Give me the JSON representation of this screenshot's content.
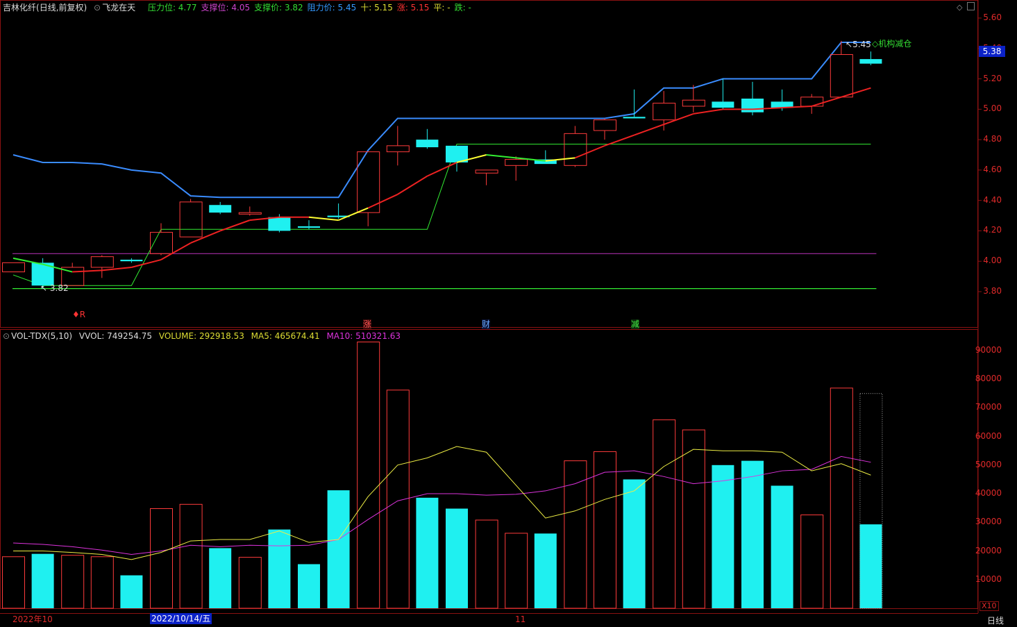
{
  "header": {
    "stock_title": "吉林化纤",
    "period": "(日线,前复权)",
    "indicator_name": "飞龙在天",
    "items": [
      {
        "label": "压力位:",
        "value": "4.77",
        "color": "#33dd33"
      },
      {
        "label": "支撑位:",
        "value": "4.05",
        "color": "#cc44cc"
      },
      {
        "label": "支撑价:",
        "value": "3.82",
        "color": "#33dd33"
      },
      {
        "label": "阻力价:",
        "value": "5.45",
        "color": "#3399ff"
      },
      {
        "label": "十:",
        "value": "5.15",
        "color": "#dddd33"
      },
      {
        "label": "涨:",
        "value": "5.15",
        "color": "#ff3333"
      },
      {
        "label": "平:",
        "value": "-",
        "color": "#dddd33"
      },
      {
        "label": "跌:",
        "value": "-",
        "color": "#33dd33"
      }
    ]
  },
  "vol_header": {
    "name": "VOL-TDX(5,10)",
    "vvol": "VVOL: 749254.75",
    "volume": "VOLUME: 292918.53",
    "ma5": "MA5: 465674.41",
    "ma10": "MA10: 510321.63"
  },
  "price_axis": [
    "5.60",
    "5.40",
    "5.20",
    "5.00",
    "4.80",
    "4.60",
    "4.40",
    "4.20",
    "4.00",
    "3.80"
  ],
  "price_tag": "5.38",
  "vol_axis": [
    "90000",
    "80000",
    "70000",
    "60000",
    "50000",
    "40000",
    "30000",
    "20000",
    "10000"
  ],
  "vol_unit": "X10",
  "annotations": {
    "high_label": "5.45",
    "low_label": "3.82",
    "event_label": "◇机构减仓",
    "marker_r": "R",
    "marker_zhang": "涨",
    "marker_cai": "财",
    "marker_jian": "减"
  },
  "bottom": {
    "date1": "2022年10",
    "selected_date": "2022/10/14/五",
    "date2": "11",
    "period_button": "日线"
  },
  "colors": {
    "up": "#ff3b3b",
    "down": "#1ff0f0",
    "bg": "#000000",
    "grid": "#7a1010"
  },
  "chart_data": {
    "type": "candlestick",
    "candles": [
      {
        "o": 3.93,
        "c": 3.99,
        "h": 3.99,
        "l": 3.93,
        "up": true
      },
      {
        "o": 3.99,
        "c": 3.84,
        "h": 4.02,
        "l": 3.82,
        "up": false
      },
      {
        "o": 3.84,
        "c": 3.96,
        "h": 3.99,
        "l": 3.84,
        "up": true
      },
      {
        "o": 3.96,
        "c": 4.03,
        "h": 4.04,
        "l": 3.89,
        "up": true
      },
      {
        "o": 4.01,
        "c": 4.0,
        "h": 4.02,
        "l": 3.99,
        "up": false
      },
      {
        "o": 4.05,
        "c": 4.19,
        "h": 4.25,
        "l": 4.04,
        "up": true
      },
      {
        "o": 4.16,
        "c": 4.39,
        "h": 4.41,
        "l": 4.16,
        "up": true
      },
      {
        "o": 4.37,
        "c": 4.32,
        "h": 4.39,
        "l": 4.31,
        "up": false
      },
      {
        "o": 4.31,
        "c": 4.32,
        "h": 4.36,
        "l": 4.3,
        "up": true
      },
      {
        "o": 4.29,
        "c": 4.2,
        "h": 4.31,
        "l": 4.19,
        "up": false
      },
      {
        "o": 4.23,
        "c": 4.22,
        "h": 4.27,
        "l": 4.21,
        "up": false
      },
      {
        "o": 4.3,
        "c": 4.29,
        "h": 4.38,
        "l": 4.28,
        "up": false
      },
      {
        "o": 4.32,
        "c": 4.72,
        "h": 4.72,
        "l": 4.23,
        "up": true
      },
      {
        "o": 4.72,
        "c": 4.76,
        "h": 4.89,
        "l": 4.63,
        "up": true
      },
      {
        "o": 4.8,
        "c": 4.75,
        "h": 4.87,
        "l": 4.74,
        "up": false
      },
      {
        "o": 4.76,
        "c": 4.65,
        "h": 4.76,
        "l": 4.59,
        "up": false
      },
      {
        "o": 4.58,
        "c": 4.6,
        "h": 4.6,
        "l": 4.5,
        "up": true
      },
      {
        "o": 4.63,
        "c": 4.67,
        "h": 4.69,
        "l": 4.53,
        "up": true
      },
      {
        "o": 4.67,
        "c": 4.64,
        "h": 4.73,
        "l": 4.64,
        "up": false
      },
      {
        "o": 4.63,
        "c": 4.84,
        "h": 4.89,
        "l": 4.62,
        "up": true
      },
      {
        "o": 4.86,
        "c": 4.93,
        "h": 4.94,
        "l": 4.8,
        "up": true
      },
      {
        "o": 4.95,
        "c": 4.94,
        "h": 5.13,
        "l": 4.94,
        "up": false
      },
      {
        "o": 4.93,
        "c": 5.04,
        "h": 5.12,
        "l": 4.86,
        "up": true
      },
      {
        "o": 5.02,
        "c": 5.06,
        "h": 5.16,
        "l": 4.98,
        "up": true
      },
      {
        "o": 5.05,
        "c": 5.01,
        "h": 5.2,
        "l": 5.0,
        "up": false
      },
      {
        "o": 5.07,
        "c": 4.98,
        "h": 5.18,
        "l": 4.96,
        "up": false
      },
      {
        "o": 5.05,
        "c": 5.01,
        "h": 5.13,
        "l": 4.99,
        "up": false
      },
      {
        "o": 5.02,
        "c": 5.08,
        "h": 5.1,
        "l": 4.97,
        "up": true
      },
      {
        "o": 5.08,
        "c": 5.36,
        "h": 5.45,
        "l": 5.08,
        "up": true
      },
      {
        "o": 5.33,
        "c": 5.3,
        "h": 5.38,
        "l": 5.29,
        "up": false
      }
    ],
    "ma_line": [
      4.02,
      3.98,
      3.93,
      3.94,
      3.96,
      4.01,
      4.12,
      4.2,
      4.27,
      4.29,
      4.29,
      4.27,
      4.35,
      4.44,
      4.56,
      4.65,
      4.7,
      4.68,
      4.66,
      4.68,
      4.76,
      4.83,
      4.9,
      4.97,
      5.0,
      5.0,
      5.01,
      5.02,
      5.08,
      5.14
    ],
    "resist_line": [
      4.7,
      4.65,
      4.65,
      4.64,
      4.6,
      4.58,
      4.43,
      4.42,
      4.42,
      4.42,
      4.42,
      4.42,
      4.73,
      4.94,
      4.94,
      4.94,
      4.94,
      4.94,
      4.94,
      4.94,
      4.94,
      4.97,
      5.14,
      5.14,
      5.2,
      5.2,
      5.2,
      5.2,
      5.44,
      5.44
    ],
    "support_step": [
      3.91,
      3.84,
      3.84,
      3.84,
      3.84,
      4.21,
      4.21,
      4.21,
      4.21,
      4.21,
      4.21,
      4.21,
      4.21,
      4.21,
      4.21,
      4.77,
      4.77,
      4.77,
      4.77,
      4.77,
      4.77,
      4.77,
      4.77,
      4.77,
      4.77,
      4.77,
      4.77,
      4.77,
      4.77,
      4.77
    ],
    "level_lines": {
      "pressure": 4.77,
      "support": 4.05,
      "support_price": 3.82
    },
    "volumes": [
      18000,
      19000,
      18500,
      18000,
      11500,
      34800,
      36300,
      21000,
      17800,
      27500,
      15400,
      41200,
      93000,
      76200,
      38600,
      34800,
      30800,
      26200,
      26100,
      51500,
      54700,
      45000,
      65800,
      62300,
      50000,
      51500,
      42800,
      32600,
      76900,
      29300
    ],
    "vol_ma5": [
      20000,
      20000,
      19500,
      18800,
      17000,
      19500,
      23500,
      24000,
      24000,
      27000,
      23000,
      24000,
      39000,
      50000,
      52500,
      56500,
      54500,
      43000,
      31500,
      34000,
      38000,
      41000,
      49500,
      55500,
      55000,
      55000,
      54500,
      48000,
      50500,
      46500
    ],
    "vol_ma10": [
      22800,
      22300,
      21500,
      20300,
      18800,
      20000,
      22000,
      21500,
      22000,
      21800,
      22000,
      24000,
      31000,
      37500,
      40000,
      40000,
      39500,
      39800,
      41000,
      43500,
      47500,
      48000,
      46000,
      43500,
      44500,
      46000,
      48000,
      48500,
      53000,
      51000
    ],
    "vol_ylim": [
      0,
      97000
    ],
    "price_ylim": [
      3.6,
      5.66
    ]
  }
}
